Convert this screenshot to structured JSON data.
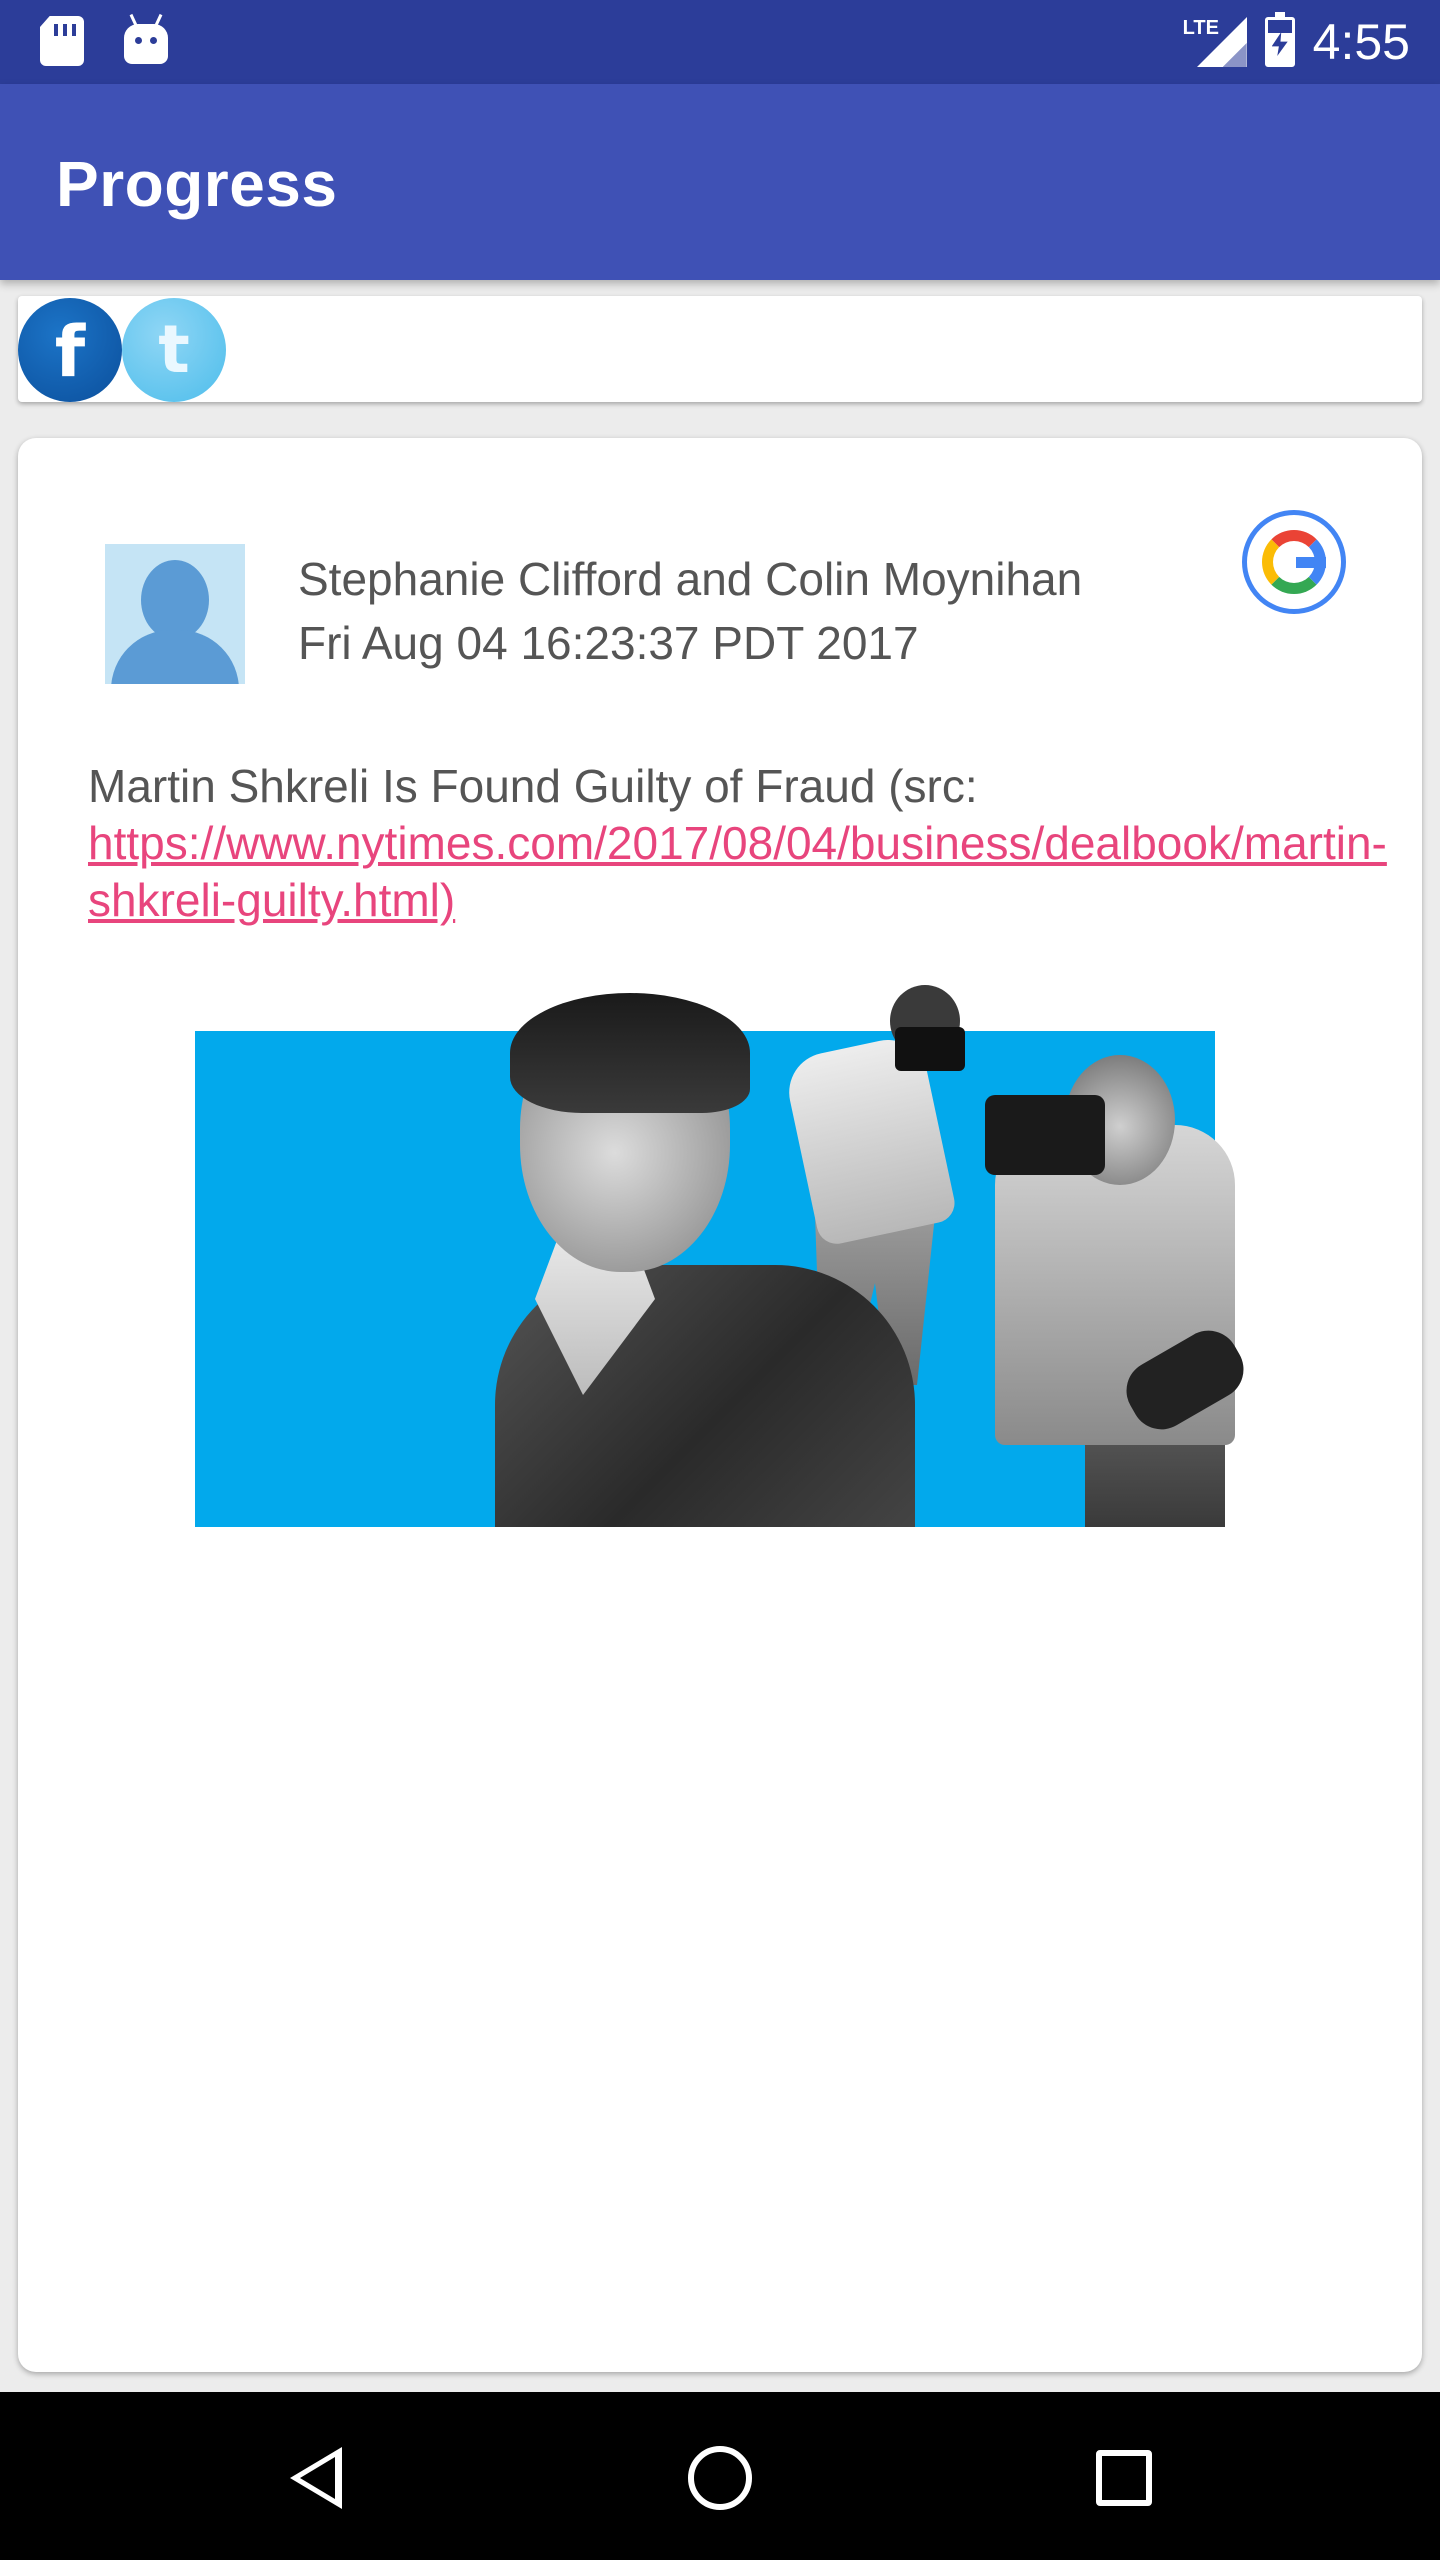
{
  "status_bar": {
    "time": "4:55",
    "network": "LTE",
    "icons": [
      "sd-card-icon",
      "android-icon",
      "lte-signal-icon",
      "battery-charging-icon"
    ]
  },
  "app_bar": {
    "title": "Progress"
  },
  "share_bar": {
    "facebook_glyph": "f",
    "twitter_glyph": "t"
  },
  "post": {
    "author": "Stephanie Clifford and Colin Moynihan",
    "date": "Fri Aug 04 16:23:37 PDT 2017",
    "source_icon": "google-icon",
    "headline_text": "Martin Shkreli Is Found Guilty of Fraud (src: ",
    "link_text": "https://www.nytimes.com/2017/08/04/business/dealbook/martin-shkreli-guilty.html)"
  },
  "colors": {
    "status_bar": "#2c3d99",
    "app_bar": "#3f51b5",
    "link": "#e8457d",
    "image_background": "#02a9ec"
  },
  "nav_bar": {
    "icons": [
      "back-icon",
      "home-icon",
      "recents-icon"
    ]
  }
}
